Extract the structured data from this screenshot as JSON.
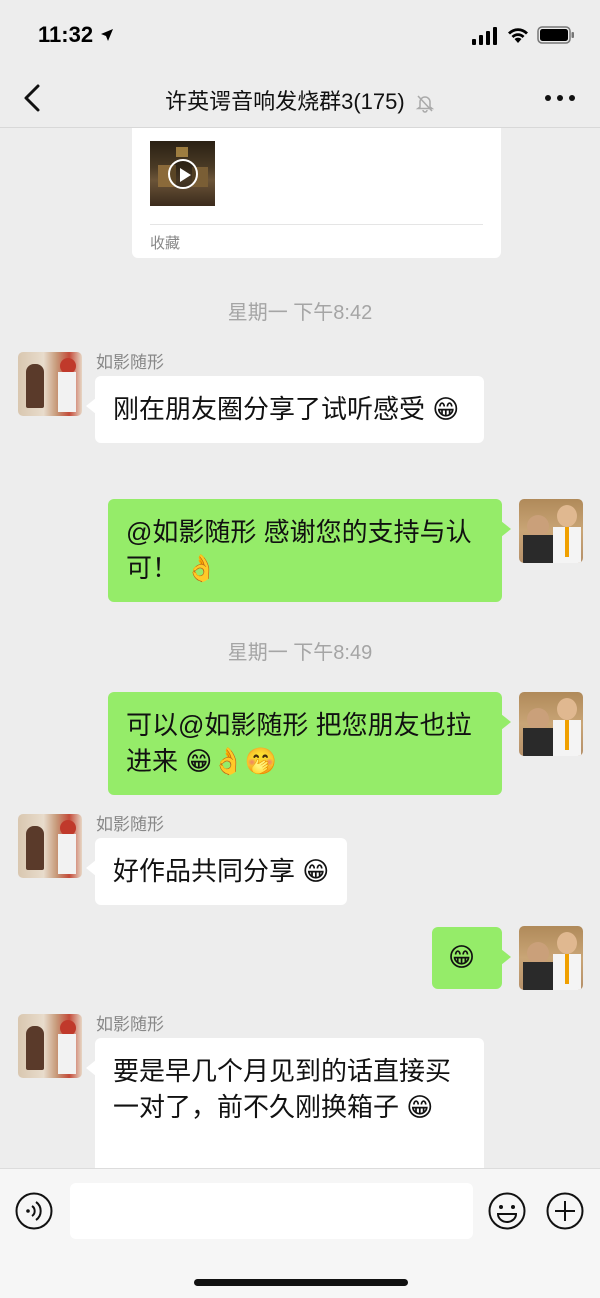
{
  "status_bar": {
    "time": "11:32"
  },
  "nav": {
    "title": "许英谔音响发烧群3(175)"
  },
  "favorite_card": {
    "label": "收藏"
  },
  "timestamps": [
    "星期一 下午8:42",
    "星期一 下午8:49"
  ],
  "messages": [
    {
      "side": "left",
      "sender": "如影随形",
      "text": "刚在朋友圈分享了试听感受",
      "emoji": "😁"
    },
    {
      "side": "right",
      "text": "@如影随形 感谢您的支持与认可！",
      "emoji": "👌"
    },
    {
      "side": "right",
      "text": "可以@如影随形 把您朋友也拉进来",
      "emoji": "😁👌🤭"
    },
    {
      "side": "left",
      "sender": "如影随形",
      "text": "好作品共同分享",
      "emoji": "😁"
    },
    {
      "side": "right",
      "text": "",
      "emoji": "😁"
    },
    {
      "side": "left",
      "sender": "如影随形",
      "text": "要是早几个月见到的话直接买一对了，前不久刚换箱子",
      "emoji": "😁"
    }
  ],
  "icons": {
    "back": "chevron-left-icon",
    "mute": "bell-slash-icon",
    "more": "more-dots-icon",
    "voice": "voice-icon",
    "emoji": "smiley-icon",
    "plus": "plus-circle-icon"
  },
  "colors": {
    "background": "#ededed",
    "bubble_self": "#95ec69",
    "bubble_other": "#ffffff",
    "timestamp": "#a5a5a5"
  }
}
